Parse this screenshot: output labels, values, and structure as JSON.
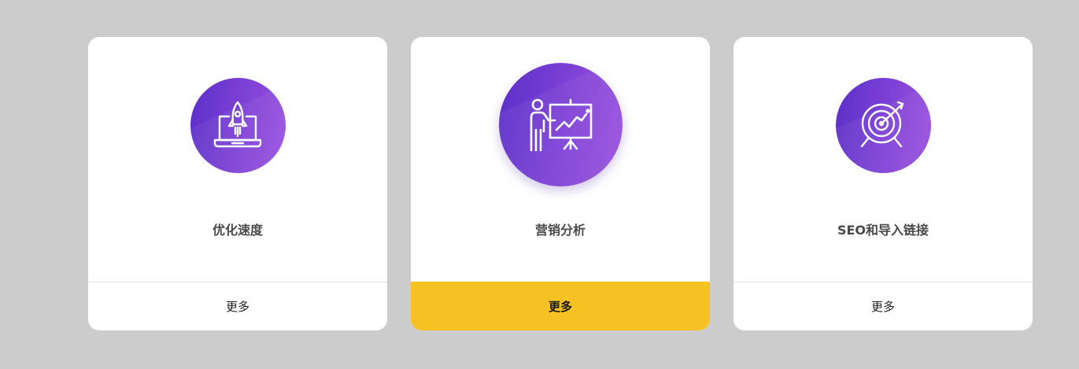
{
  "cards": [
    {
      "title": "优化速度",
      "more_label": "更多",
      "icon": "rocket-laptop-icon"
    },
    {
      "title": "营销分析",
      "more_label": "更多",
      "icon": "presentation-chart-icon"
    },
    {
      "title": "SEO和导入链接",
      "more_label": "更多",
      "icon": "target-arrow-icon"
    }
  ],
  "colors": {
    "background": "#cccccc",
    "card": "#ffffff",
    "accent_yellow": "#f5c123",
    "icon_gradient_start": "#5a2fc8",
    "icon_gradient_end": "#9c52e0",
    "title_text": "#4a4a4a"
  }
}
